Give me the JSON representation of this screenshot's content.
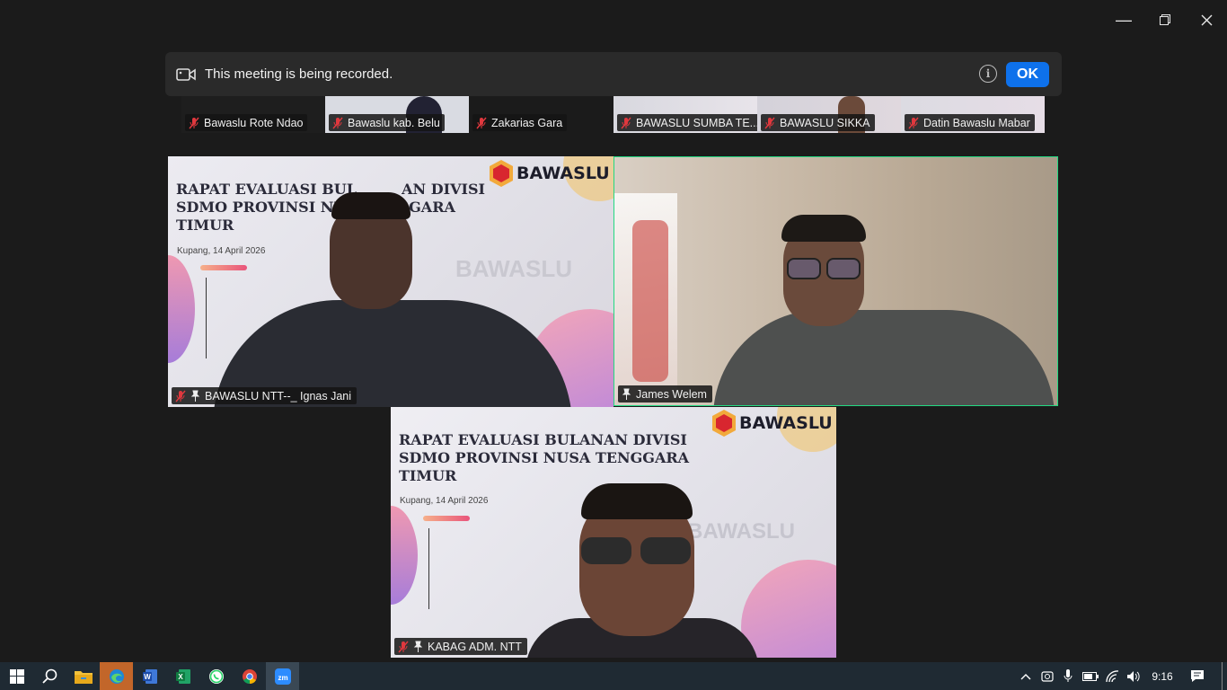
{
  "recording_banner": {
    "text": "This meeting is being recorded.",
    "ok_label": "OK"
  },
  "thumbnails": [
    {
      "name": "Bawaslu Rote Ndao"
    },
    {
      "name": "Bawaslu kab. Belu"
    },
    {
      "name": "Zakarias Gara"
    },
    {
      "name": "BAWASLU SUMBA TE..."
    },
    {
      "name": "BAWASLU SIKKA"
    },
    {
      "name": "Datin Bawaslu Mabar"
    }
  ],
  "tiles": {
    "left": {
      "name": "BAWASLU NTT--_ Ignas Jani"
    },
    "right": {
      "name": "James Welem"
    },
    "bottom": {
      "name": "KABAG ADM. NTT"
    }
  },
  "slide": {
    "title_line1": "RAPAT EVALUASI BULANAN DIVISI",
    "title_line2": "SDMO PROVINSI NUSA TENGGARA",
    "title_line3": "TIMUR",
    "title_left_line1": "RAPAT EVALUASI BUL",
    "title_left_line1b": "AN DIVISI",
    "title_left_line2": "SDMO PROVINSI NUS",
    "title_left_line2b": "GGARA",
    "date": "Kupang, 14 April 2026",
    "logo_text": "BAWASLU",
    "watermark": "BAWASLU"
  },
  "taskbar": {
    "time": "9:16"
  },
  "colors": {
    "active_speaker": "#23d982",
    "ok_button": "#0e71eb",
    "mic_muted": "#e0383e"
  }
}
